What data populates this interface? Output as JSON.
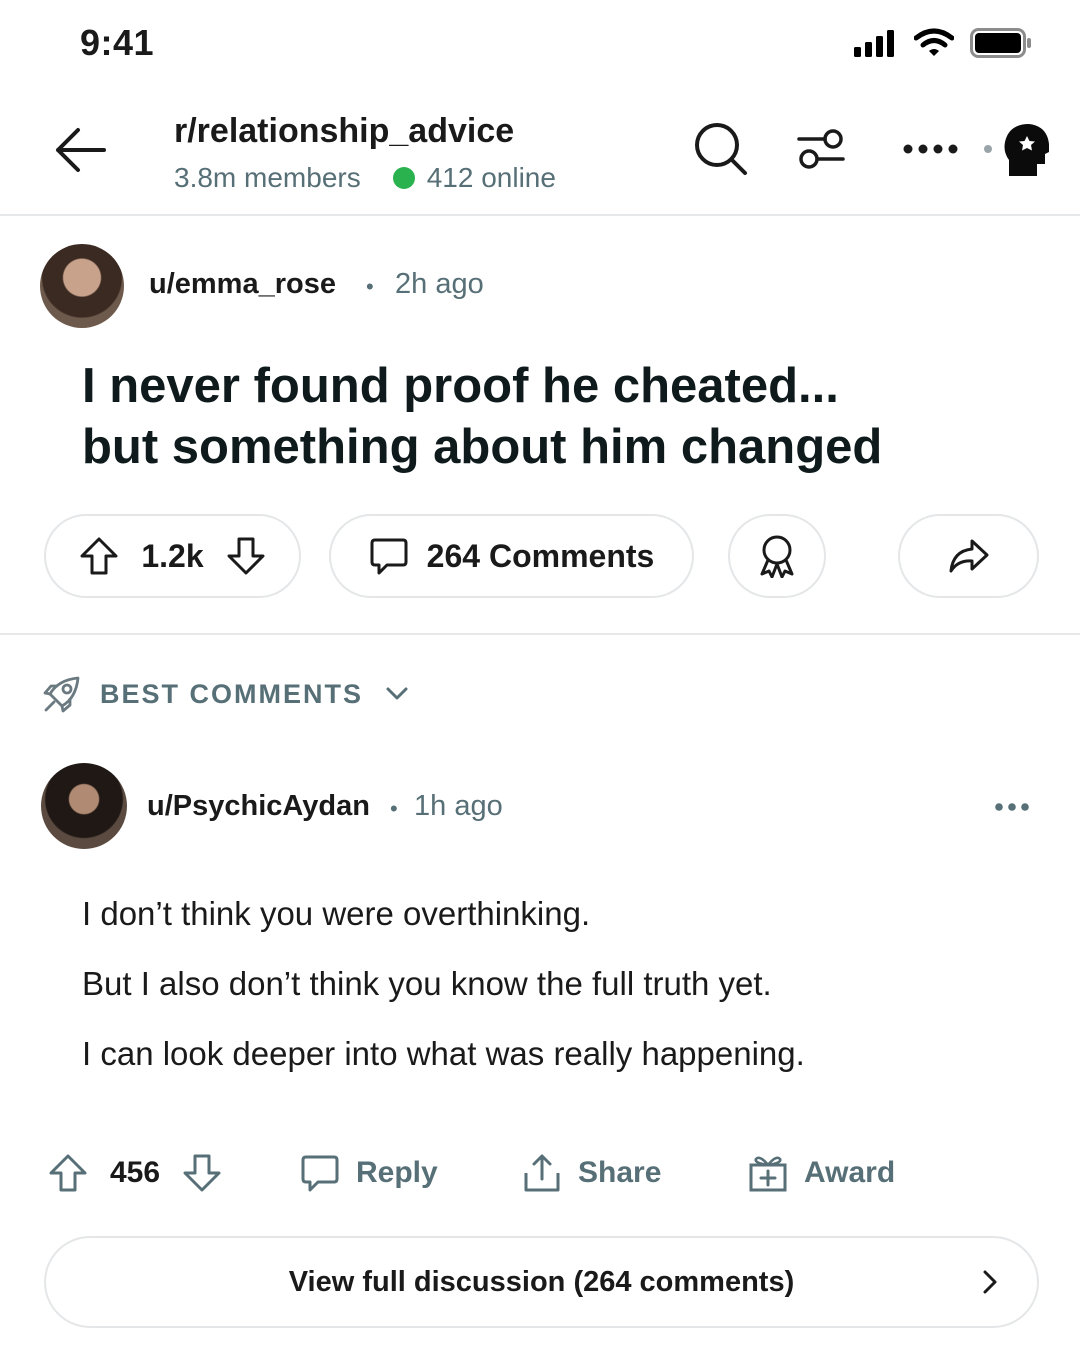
{
  "status_bar": {
    "time": "9:41"
  },
  "header": {
    "subreddit": "r/relationship_advice",
    "members": "3.8m members",
    "online": "412 online",
    "online_color": "#2ab24f",
    "icons": [
      "back-arrow-icon",
      "search-icon",
      "filter-icon",
      "more-icon",
      "profile-icon"
    ]
  },
  "post": {
    "author": "u/emma_rose",
    "separator": "•",
    "time": "2h ago",
    "title_line1": "I never found proof he cheated...",
    "title_line2": "but something about him changed",
    "score": "1.2k",
    "comments_label": "264 Comments"
  },
  "comments_section": {
    "sort_label": "BEST COMMENTS"
  },
  "comment": {
    "author": "u/PsychicAydan",
    "separator": "•",
    "time": "1h ago",
    "lines": [
      "I don’t think you were overthinking.",
      "But I also don’t think you know the full truth yet.",
      "I can look deeper into what was really happening."
    ],
    "score": "456",
    "reply_label": "Reply",
    "share_label": "Share",
    "award_label": "Award"
  },
  "view_full": {
    "label": "View full discussion (264 comments)"
  }
}
